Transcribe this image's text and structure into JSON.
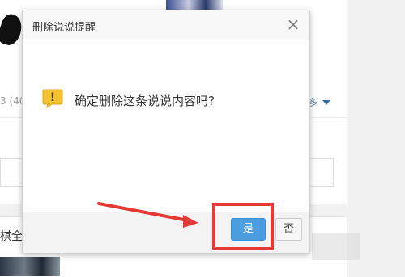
{
  "dialog": {
    "title": "删除说说提醒",
    "close_label": "×",
    "message": "确定删除这条说说内容吗?",
    "warning_glyph": "!",
    "buttons": {
      "yes": "是",
      "no": "否"
    }
  },
  "background": {
    "meta_text": "3 (40",
    "more_text": "多",
    "name_text": "棋全"
  },
  "colors": {
    "primary_button": "#4a9ee0",
    "annotation_red": "#e53935",
    "warning_yellow": "#f2c230"
  }
}
